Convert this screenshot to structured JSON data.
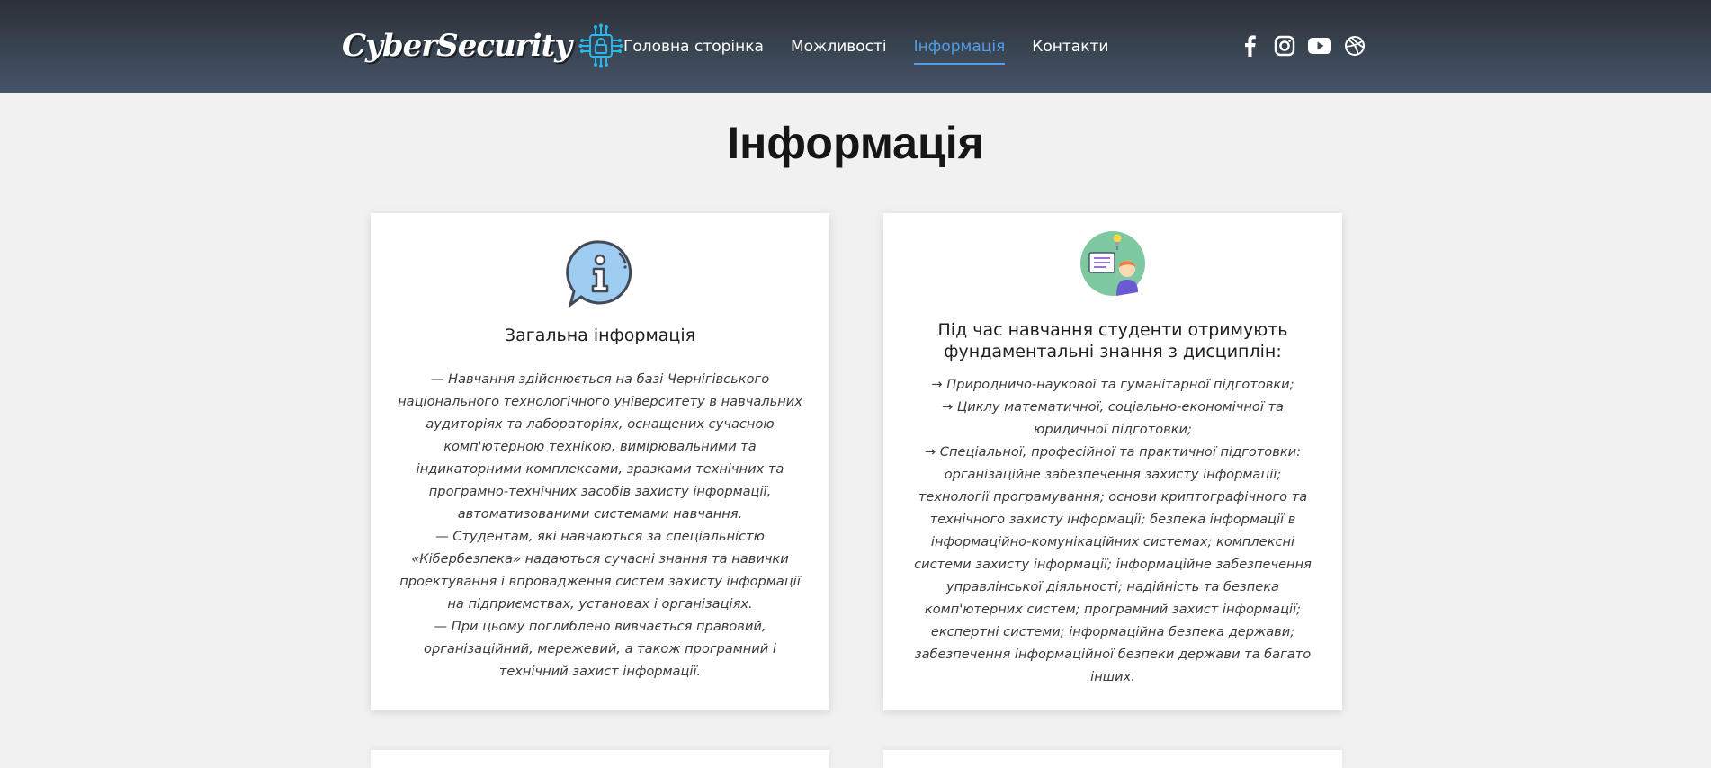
{
  "header": {
    "logo_text": "CyberSecurity",
    "nav": [
      {
        "label": "Головна сторінка",
        "active": false
      },
      {
        "label": "Можливості",
        "active": false
      },
      {
        "label": "Інформація",
        "active": true
      },
      {
        "label": "Контакти",
        "active": false
      }
    ],
    "social_icons": [
      "facebook-icon",
      "instagram-icon",
      "youtube-icon",
      "dribbble-icon"
    ]
  },
  "main": {
    "page_title": "Інформація",
    "cards": [
      {
        "icon": "info-speech-bubble-icon",
        "title": "Загальна інформація",
        "paragraphs": [
          "— Навчання здійснюється на базі Чернігівського національного технологічного університету в навчальних аудиторіях та лабораторіях, оснащених сучасною комп'ютерною технікою, вимірювальними та індикаторними комплексами, зразками технічних та програмно-технічних засобів захисту інформації, автоматизованими системами навчання.",
          "— Студентам, які навчаються за спеціальністю «Кібербезпека» надаються сучасні знання та навички проектування і впровадження систем захисту інформації на підприємствах, установах і організаціях.",
          "— При цьому поглиблено вивчається правовий, організаційний, мережевий, а також програмний і технічний захист інформації."
        ]
      },
      {
        "icon": "student-learning-icon",
        "title": "Під час навчання студенти отримують фундаментальні знання з дисциплін:",
        "paragraphs": [
          "→ Природничо-наукової та гуманітарної підготовки;",
          "→ Циклу математичної, соціально-економічної та юридичної підготовки;",
          "→ Спеціальної, професійної та практичної підготовки: організаційне забезпечення захисту інформації; технології програмування; основи криптографічного та технічного захисту інформації; безпека інформації в інформаційно-комунікаційних системах; комплексні системи захисту інформації; інформаційне забезпечення управлінської діяльності; надійність та безпека комп'ютерних систем; програмний захист інформації; експертні системи; інформаційна безпека держави; забезпечення інформаційної безпеки держави та багато інших."
        ]
      }
    ]
  },
  "colors": {
    "header_dark": "#2b3038",
    "accent": "#4f9fe8",
    "background": "#f1f1f1",
    "card": "#ffffff"
  }
}
